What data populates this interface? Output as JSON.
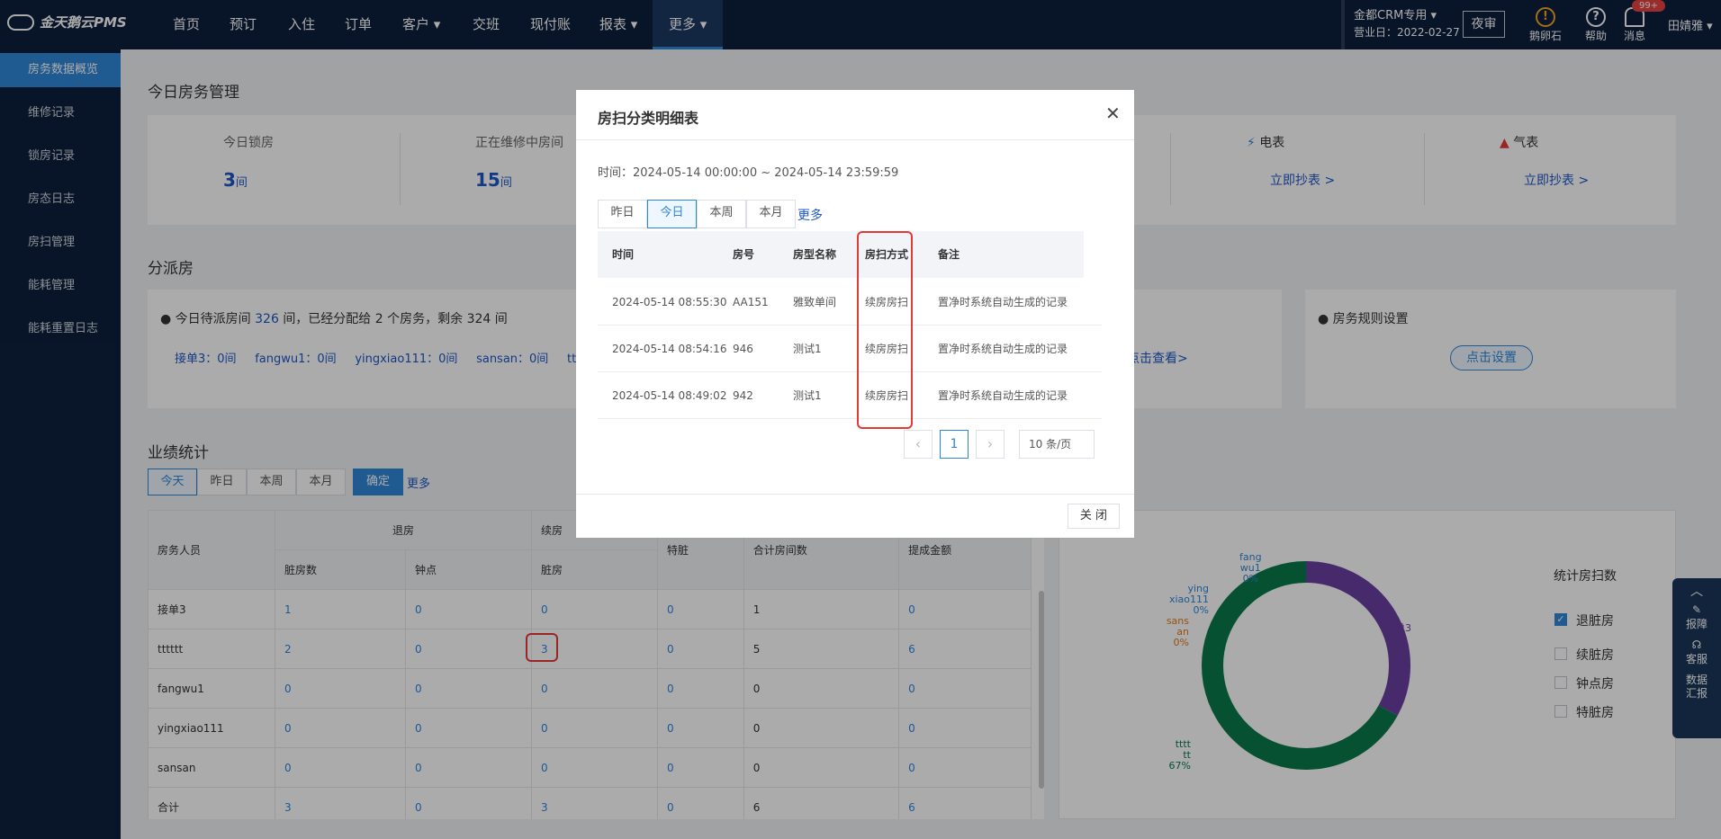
{
  "app": {
    "logo": "金天鹅云PMS"
  },
  "topnav": {
    "items": [
      "首页",
      "预订",
      "入住",
      "订单",
      "客户 ▾",
      "交班",
      "现付账",
      "报表 ▾",
      "更多 ▾"
    ]
  },
  "topright": {
    "crm": "金都CRM专用 ▾",
    "date": "营业日：2022-02-27",
    "night": "夜审",
    "icon1": "鹅卵石",
    "icon2": "帮助",
    "icon3": "消息",
    "badge": "99+",
    "user": "田婧雅 ▾"
  },
  "sidebar": {
    "items": [
      "房务数据概览",
      "维修记录",
      "锁房记录",
      "房态日志",
      "房扫管理",
      "能耗管理",
      "能耗重置日志"
    ]
  },
  "today": {
    "title": "今日房务管理",
    "lock_label": "今日锁房",
    "lock_val": "3",
    "lock_unit": "间",
    "repair_label": "正在维修中房间",
    "repair_val": "15",
    "repair_unit": "间",
    "elec": "电表",
    "elec_link": "立即抄表 >",
    "gas": "气表",
    "gas_link": "立即抄表 >"
  },
  "assign": {
    "title": "分派房",
    "summary_pre": "今日待派房间",
    "summary_num": "326",
    "summary_post": "间，已经分配给 2 个房务，剩余 324 间",
    "staff_line": "接单3：0间     fangwu1：0间     yingxiao111：0间     sansan：0间     tttttt：",
    "view_link": "点击查看>",
    "rule_title": "房务规则设置",
    "rule_btn": "点击设置"
  },
  "perf": {
    "title": "业绩统计",
    "tabs": [
      "今天",
      "昨日",
      "本周",
      "本月"
    ],
    "confirm": "确定",
    "more": "更多",
    "head1": [
      "房务人员",
      "退房",
      "续房",
      "特脏",
      "合计房间数",
      "提成金额"
    ],
    "head2": [
      "脏房数",
      "钟点",
      "脏房"
    ],
    "rows": [
      [
        "接单3",
        "1",
        "0",
        "0",
        "0",
        "1",
        "0"
      ],
      [
        "tttttt",
        "2",
        "0",
        "3",
        "0",
        "5",
        "6"
      ],
      [
        "fangwu1",
        "0",
        "0",
        "0",
        "0",
        "0",
        "0"
      ],
      [
        "yingxiao111",
        "0",
        "0",
        "0",
        "0",
        "0",
        "0"
      ],
      [
        "sansan",
        "0",
        "0",
        "0",
        "0",
        "0",
        "0"
      ],
      [
        "合计",
        "3",
        "0",
        "3",
        "0",
        "6",
        "6"
      ]
    ]
  },
  "chart_data": {
    "type": "pie",
    "title": "",
    "slices": [
      {
        "label": "接单3",
        "value": 33,
        "text": "33%",
        "color": "#6b3fa0"
      },
      {
        "label": "tttttt",
        "value": 67,
        "text": "67%",
        "color": "#0a7a4a"
      },
      {
        "label": "fangwu1",
        "value": 0,
        "text": "0%",
        "color": "#2f86d8"
      },
      {
        "label": "yingxiao111",
        "value": 0,
        "text": "0%",
        "color": "#2f86d8"
      },
      {
        "label": "sansan",
        "value": 0,
        "text": "0%",
        "color": "#e07b1a"
      }
    ],
    "legend_title": "统计房扫数",
    "legend": [
      "退脏房",
      "续脏房",
      "钟点房",
      "特脏房"
    ],
    "legend_checked": [
      true,
      false,
      false,
      false
    ]
  },
  "labels": {
    "fangwu": [
      "fang",
      "wu1",
      "0%"
    ],
    "ying": [
      "ying",
      "xiao111",
      "0%"
    ],
    "sans": [
      "sans",
      "an",
      "0%"
    ],
    "jd": [
      "接单3",
      "33%"
    ],
    "tt": [
      "tttt",
      "tt",
      "67%"
    ]
  },
  "float": {
    "a": "报障",
    "b": "客服",
    "c": "数据",
    "d": "汇报"
  },
  "modal": {
    "title": "房扫分类明细表",
    "time_label": "时间：",
    "time_range": "2024-05-14 00:00:00 ~ 2024-05-14 23:59:59",
    "tabs": [
      "昨日",
      "今日",
      "本周",
      "本月"
    ],
    "more": "更多",
    "cols": [
      "时间",
      "房号",
      "房型名称",
      "房扫方式",
      "备注"
    ],
    "rows": [
      [
        "2024-05-14 08:55:30",
        "AA151",
        "雅致单间",
        "续房房扫",
        "置净时系统自动生成的记录"
      ],
      [
        "2024-05-14 08:54:16",
        "946",
        "测试1",
        "续房房扫",
        "置净时系统自动生成的记录"
      ],
      [
        "2024-05-14 08:49:02",
        "942",
        "测试1",
        "续房房扫",
        "置净时系统自动生成的记录"
      ]
    ],
    "page": "1",
    "page_size": "10 条/页",
    "close": "关 闭"
  }
}
